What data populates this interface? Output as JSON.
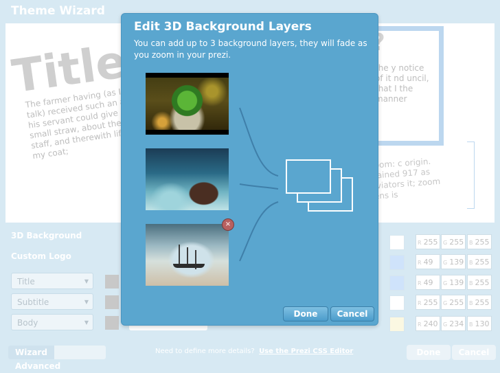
{
  "app": {
    "title": "Theme Wizard"
  },
  "preview": {
    "title": "Title",
    "body_text": "The farmer having (as I talk) received such an a his servant could give n a small straw, about the staff, and therewith lifte my coat;",
    "right_q": "?",
    "right_text": "the y notice of it nd uncil, that I the manner",
    "right_text2": "zoom: c origin. Gained 917 as aviators it; zoom lens is"
  },
  "panel": {
    "bg_label": "3D Background",
    "logo_label": "Custom Logo",
    "styles": [
      "Title",
      "Subtitle",
      "Body"
    ],
    "rgb_rows": [
      {
        "r": "255",
        "g": "255",
        "b": "255",
        "swatch": "#ffffff"
      },
      {
        "r": "49",
        "g": "139",
        "b": "255",
        "swatch": "#cfe3fb"
      },
      {
        "r": "49",
        "g": "139",
        "b": "255",
        "swatch": "#cfe3fb"
      },
      {
        "r": "255",
        "g": "255",
        "b": "255",
        "swatch": "#ffffff"
      },
      {
        "r": "240",
        "g": "234",
        "b": "130",
        "swatch": "#fbf8e2"
      }
    ],
    "channel_labels": [
      "R",
      "G",
      "B"
    ]
  },
  "footer": {
    "tab_wizard": "Wizard",
    "tab_advanced": "Advanced",
    "hint": "Need to define more details?",
    "hint_link": "Use the Prezi CSS Editor",
    "done": "Done",
    "cancel": "Cancel"
  },
  "dialog": {
    "title": "Edit 3D Background Layers",
    "subtitle": "You can add up to 3 background layers, they will fade as you zoom in your prezi.",
    "remove_glyph": "×",
    "done": "Done",
    "cancel": "Cancel",
    "colors": {
      "bg": "#5aa6cf",
      "line": "#3d7ea8"
    }
  }
}
